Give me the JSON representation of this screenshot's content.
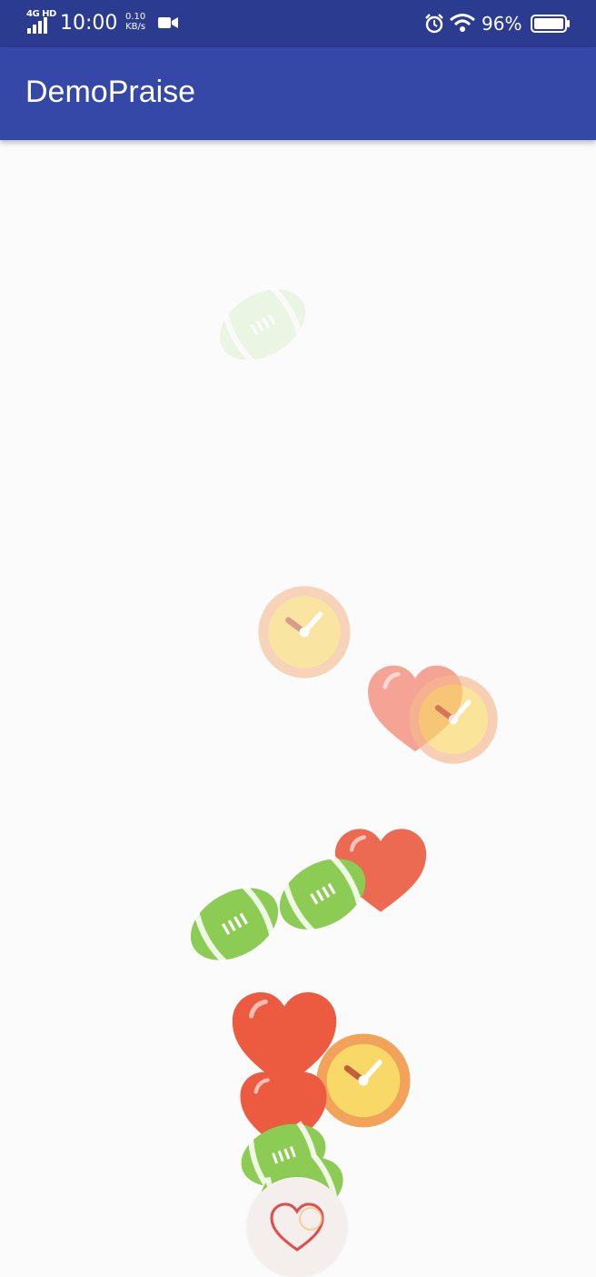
{
  "status_bar": {
    "network": "4G HD",
    "time": "10:00",
    "speed_value": "0.10",
    "speed_unit": "KB/s",
    "battery": "96%"
  },
  "app_bar": {
    "title": "DemoPraise"
  },
  "floating_items": [
    {
      "type": "football",
      "color": "#d9eec6",
      "opacity": 0.45
    },
    {
      "type": "clock",
      "color": "#f6b98f",
      "opacity": 0.6
    },
    {
      "type": "heart",
      "color": "#f28672",
      "opacity": 0.75
    },
    {
      "type": "clock",
      "color": "#f6b98f",
      "opacity": 0.65
    },
    {
      "type": "heart",
      "color": "#ec6a52",
      "opacity": 1
    },
    {
      "type": "football",
      "color": "#8dcc54",
      "opacity": 1
    },
    {
      "type": "football",
      "color": "#8dcc54",
      "opacity": 1
    },
    {
      "type": "heart",
      "color": "#ec5a40",
      "opacity": 1
    },
    {
      "type": "clock",
      "color": "#f3a25a",
      "opacity": 1
    },
    {
      "type": "heart",
      "color": "#ec5a40",
      "opacity": 1
    },
    {
      "type": "football",
      "color": "#8dcc54",
      "opacity": 1
    },
    {
      "type": "football",
      "color": "#8dcc54",
      "opacity": 1
    }
  ],
  "like_button": {
    "icon": "heart-outline-icon",
    "color": "#e14c4c"
  }
}
